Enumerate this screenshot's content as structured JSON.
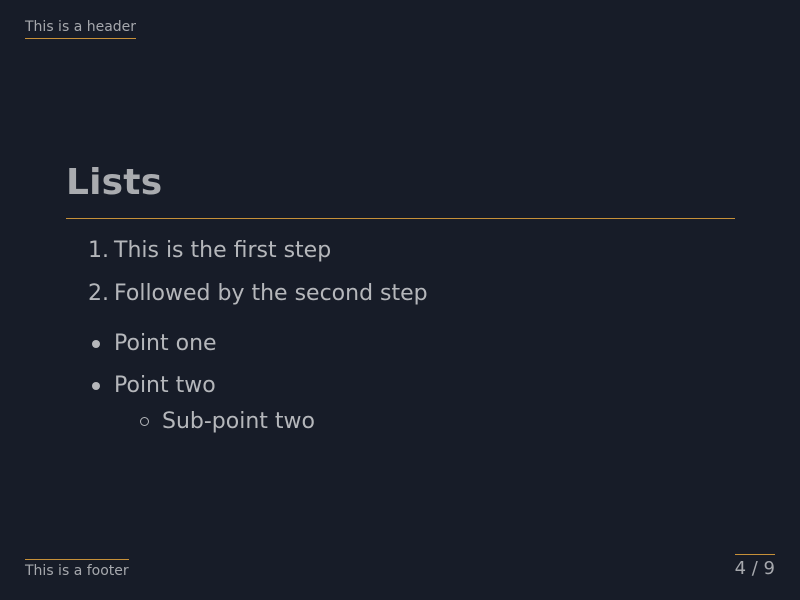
{
  "header": {
    "text": "This is a header"
  },
  "slide": {
    "title": "Lists",
    "ordered_list": [
      {
        "number": "1.",
        "text": "This is the first step"
      },
      {
        "number": "2.",
        "text": "Followed by the second step"
      }
    ],
    "bullet_list": [
      {
        "text": "Point one"
      },
      {
        "text": "Point two",
        "sub_items": [
          {
            "text": "Sub-point two"
          }
        ]
      }
    ]
  },
  "footer": {
    "text": "This is a footer",
    "page_number": "4 / 9"
  },
  "colors": {
    "background": "#171c28",
    "accent": "#c69039",
    "text": "#b5b7bb",
    "title": "#a9abaf"
  }
}
